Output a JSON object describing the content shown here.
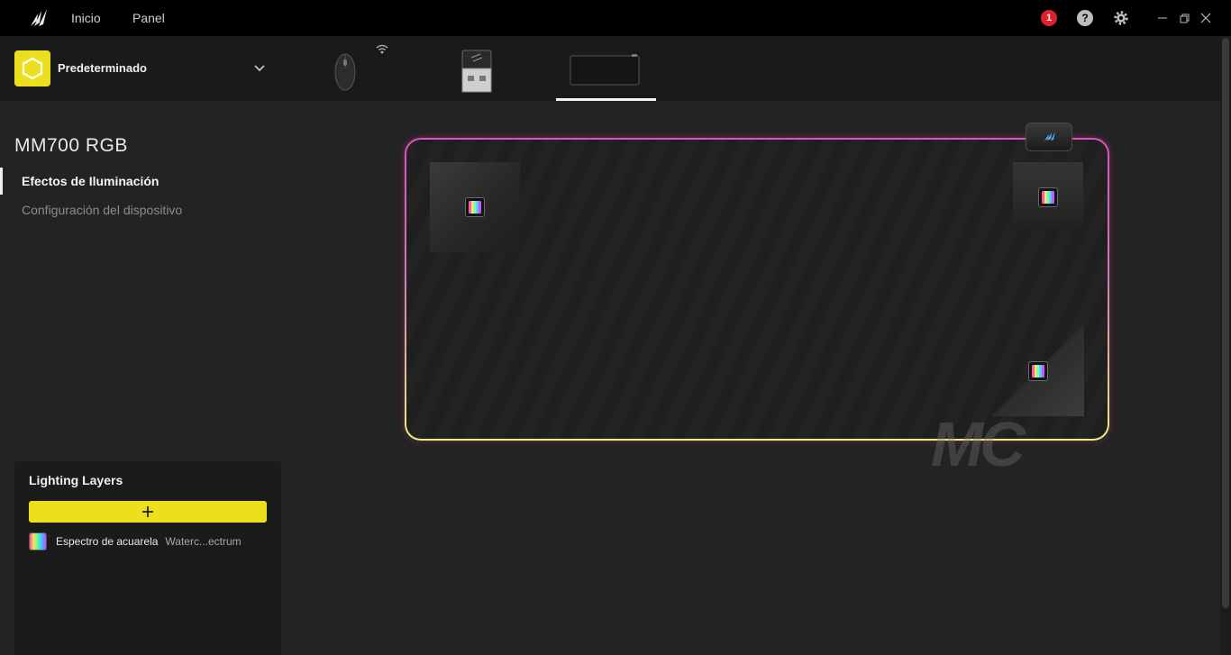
{
  "topbar": {
    "nav": [
      "Inicio",
      "Panel"
    ],
    "notification_count": "1",
    "help_label": "?"
  },
  "profile": {
    "name": "Predeterminado"
  },
  "devices": [
    "mouse",
    "usb-dongle",
    "mousepad"
  ],
  "device_page": {
    "title": "MM700 RGB",
    "menu": {
      "active": "Efectos de Iluminación",
      "inactive": "Configuración del dispositivo"
    }
  },
  "lighting_layers": {
    "title": "Lighting Layers",
    "add_label": "+",
    "layers": [
      {
        "name": "Espectro de acuarela",
        "effect": "Waterc...ectrum"
      }
    ]
  },
  "watermark": "MC",
  "colors": {
    "accent": "#ece01e",
    "pad_glow_top": "#e04fc0",
    "pad_glow_bottom": "#f0f07a",
    "notification": "#e0202a"
  }
}
